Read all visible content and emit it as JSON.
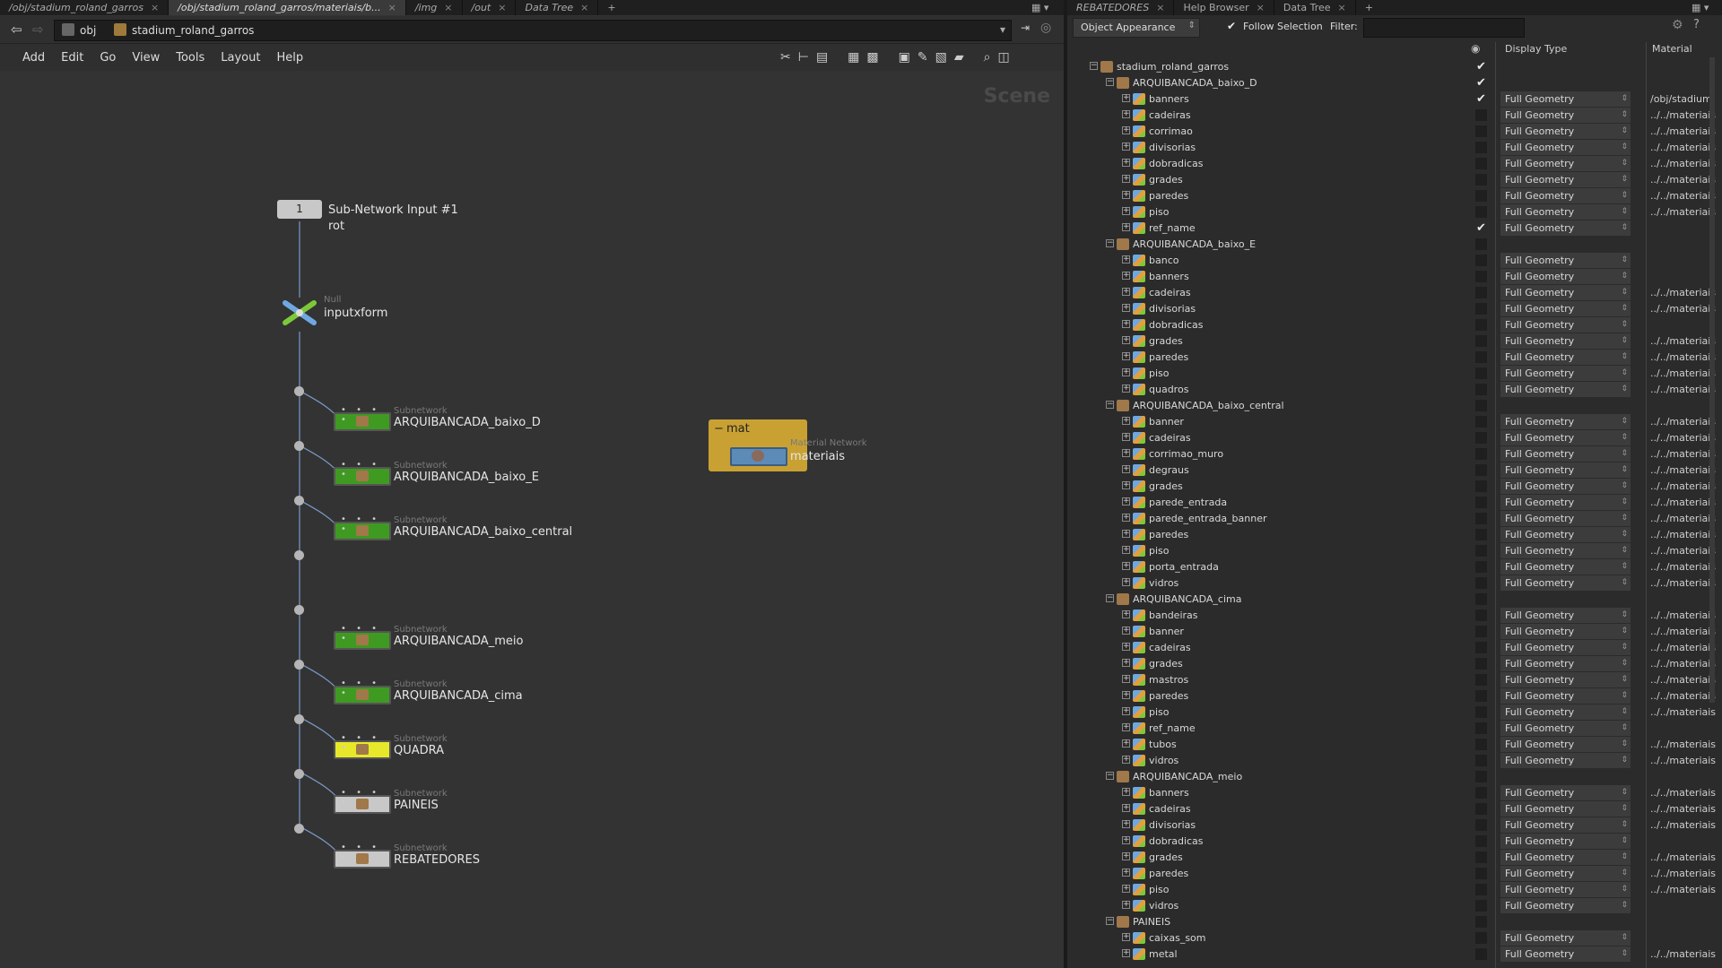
{
  "left_tabs": [
    {
      "label": "/obj/stadium_roland_garros"
    },
    {
      "label": "/obj/stadium_roland_garros/materiais/b..."
    },
    {
      "label": "/img"
    },
    {
      "label": "/out"
    },
    {
      "label": "Data Tree"
    }
  ],
  "path": {
    "root": "obj",
    "current": "stadium_roland_garros"
  },
  "menu": [
    "Add",
    "Edit",
    "Go",
    "View",
    "Tools",
    "Layout",
    "Help"
  ],
  "scene_label": "Scene",
  "nodes": {
    "input": {
      "num": "1",
      "label": "Sub-Network Input #1",
      "sub": "rot"
    },
    "null": {
      "type": "Null",
      "label": "inputxform"
    },
    "subnets": [
      {
        "type": "Subnetwork",
        "label": "ARQUIBANCADA_baixo_D",
        "color": "#3f9a22"
      },
      {
        "type": "Subnetwork",
        "label": "ARQUIBANCADA_baixo_E",
        "color": "#3f9a22"
      },
      {
        "type": "Subnetwork",
        "label": "ARQUIBANCADA_baixo_central",
        "color": "#3f9a22"
      },
      {
        "type": "Subnetwork",
        "label": "ARQUIBANCADA_meio",
        "color": "#3f9a22"
      },
      {
        "type": "Subnetwork",
        "label": "ARQUIBANCADA_cima",
        "color": "#3f9a22"
      },
      {
        "type": "Subnetwork",
        "label": "QUADRA",
        "color": "#e8e82a"
      },
      {
        "type": "Subnetwork",
        "label": "PAINEIS",
        "color": "#c8c8c8"
      },
      {
        "type": "Subnetwork",
        "label": "REBATEDORES",
        "color": "#c8c8c8"
      }
    ],
    "mat_box": {
      "title": "mat",
      "type": "Material Network",
      "label": "materiais"
    }
  },
  "right_tabs": [
    {
      "label": "REBATEDORES"
    },
    {
      "label": "Help Browser"
    },
    {
      "label": "Data Tree"
    }
  ],
  "toolbar": {
    "mode": "Object Appearance",
    "follow": "Follow Selection",
    "filter_label": "Filter:"
  },
  "headers": {
    "display": "Display Type",
    "material": "Material"
  },
  "tree": [
    {
      "name": "stadium_roland_garros",
      "level": 0,
      "kind": "root",
      "tick": true,
      "dt": "",
      "mat": ""
    },
    {
      "name": "ARQUIBANCADA_baixo_D",
      "level": 1,
      "kind": "group",
      "tick": true,
      "dt": "",
      "mat": ""
    },
    {
      "name": "banners",
      "level": 2,
      "kind": "geo",
      "tick": true,
      "dt": "Full Geometry",
      "mat": "/obj/stadium"
    },
    {
      "name": "cadeiras",
      "level": 2,
      "kind": "geo",
      "tick": false,
      "dt": "Full Geometry",
      "mat": "../../materiais"
    },
    {
      "name": "corrimao",
      "level": 2,
      "kind": "geo",
      "tick": false,
      "dt": "Full Geometry",
      "mat": "../../materiais"
    },
    {
      "name": "divisorias",
      "level": 2,
      "kind": "geo",
      "tick": false,
      "dt": "Full Geometry",
      "mat": "../../materiais"
    },
    {
      "name": "dobradicas",
      "level": 2,
      "kind": "geo",
      "tick": false,
      "dt": "Full Geometry",
      "mat": "../../materiais"
    },
    {
      "name": "grades",
      "level": 2,
      "kind": "geo",
      "tick": false,
      "dt": "Full Geometry",
      "mat": "../../materiais"
    },
    {
      "name": "paredes",
      "level": 2,
      "kind": "geo",
      "tick": false,
      "dt": "Full Geometry",
      "mat": "../../materiais"
    },
    {
      "name": "piso",
      "level": 2,
      "kind": "geo",
      "tick": false,
      "dt": "Full Geometry",
      "mat": "../../materiais"
    },
    {
      "name": "ref_name",
      "level": 2,
      "kind": "geo",
      "tick": true,
      "dt": "Full Geometry",
      "mat": ""
    },
    {
      "name": "ARQUIBANCADA_baixo_E",
      "level": 1,
      "kind": "group",
      "tick": false,
      "dt": "",
      "mat": ""
    },
    {
      "name": "banco",
      "level": 2,
      "kind": "geo",
      "tick": false,
      "dt": "Full Geometry",
      "mat": ""
    },
    {
      "name": "banners",
      "level": 2,
      "kind": "geo",
      "tick": false,
      "dt": "Full Geometry",
      "mat": ""
    },
    {
      "name": "cadeiras",
      "level": 2,
      "kind": "geo",
      "tick": false,
      "dt": "Full Geometry",
      "mat": "../../materiais"
    },
    {
      "name": "divisorias",
      "level": 2,
      "kind": "geo",
      "tick": false,
      "dt": "Full Geometry",
      "mat": "../../materiais"
    },
    {
      "name": "dobradicas",
      "level": 2,
      "kind": "geo",
      "tick": false,
      "dt": "Full Geometry",
      "mat": ""
    },
    {
      "name": "grades",
      "level": 2,
      "kind": "geo",
      "tick": false,
      "dt": "Full Geometry",
      "mat": "../../materiais"
    },
    {
      "name": "paredes",
      "level": 2,
      "kind": "geo",
      "tick": false,
      "dt": "Full Geometry",
      "mat": "../../materiais"
    },
    {
      "name": "piso",
      "level": 2,
      "kind": "geo",
      "tick": false,
      "dt": "Full Geometry",
      "mat": "../../materiais"
    },
    {
      "name": "quadros",
      "level": 2,
      "kind": "geo",
      "tick": false,
      "dt": "Full Geometry",
      "mat": "../../materiais"
    },
    {
      "name": "ARQUIBANCADA_baixo_central",
      "level": 1,
      "kind": "group",
      "tick": false,
      "dt": "",
      "mat": ""
    },
    {
      "name": "banner",
      "level": 2,
      "kind": "geo",
      "tick": false,
      "dt": "Full Geometry",
      "mat": "../../materiais"
    },
    {
      "name": "cadeiras",
      "level": 2,
      "kind": "geo",
      "tick": false,
      "dt": "Full Geometry",
      "mat": "../../materiais"
    },
    {
      "name": "corrimao_muro",
      "level": 2,
      "kind": "geo",
      "tick": false,
      "dt": "Full Geometry",
      "mat": "../../materiais"
    },
    {
      "name": "degraus",
      "level": 2,
      "kind": "geo",
      "tick": false,
      "dt": "Full Geometry",
      "mat": "../../materiais"
    },
    {
      "name": "grades",
      "level": 2,
      "kind": "geo",
      "tick": false,
      "dt": "Full Geometry",
      "mat": "../../materiais"
    },
    {
      "name": "parede_entrada",
      "level": 2,
      "kind": "geo",
      "tick": false,
      "dt": "Full Geometry",
      "mat": "../../materiais"
    },
    {
      "name": "parede_entrada_banner",
      "level": 2,
      "kind": "geo",
      "tick": false,
      "dt": "Full Geometry",
      "mat": "../../materiais"
    },
    {
      "name": "paredes",
      "level": 2,
      "kind": "geo",
      "tick": false,
      "dt": "Full Geometry",
      "mat": "../../materiais"
    },
    {
      "name": "piso",
      "level": 2,
      "kind": "geo",
      "tick": false,
      "dt": "Full Geometry",
      "mat": "../../materiais"
    },
    {
      "name": "porta_entrada",
      "level": 2,
      "kind": "geo",
      "tick": false,
      "dt": "Full Geometry",
      "mat": "../../materiais"
    },
    {
      "name": "vidros",
      "level": 2,
      "kind": "geo",
      "tick": false,
      "dt": "Full Geometry",
      "mat": "../../materiais"
    },
    {
      "name": "ARQUIBANCADA_cima",
      "level": 1,
      "kind": "group",
      "tick": false,
      "dt": "",
      "mat": ""
    },
    {
      "name": "bandeiras",
      "level": 2,
      "kind": "geo",
      "tick": false,
      "dt": "Full Geometry",
      "mat": "../../materiais"
    },
    {
      "name": "banner",
      "level": 2,
      "kind": "geo",
      "tick": false,
      "dt": "Full Geometry",
      "mat": "../../materiais"
    },
    {
      "name": "cadeiras",
      "level": 2,
      "kind": "geo",
      "tick": false,
      "dt": "Full Geometry",
      "mat": "../../materiais"
    },
    {
      "name": "grades",
      "level": 2,
      "kind": "geo",
      "tick": false,
      "dt": "Full Geometry",
      "mat": "../../materiais"
    },
    {
      "name": "mastros",
      "level": 2,
      "kind": "geo",
      "tick": false,
      "dt": "Full Geometry",
      "mat": "../../materiais"
    },
    {
      "name": "paredes",
      "level": 2,
      "kind": "geo",
      "tick": false,
      "dt": "Full Geometry",
      "mat": "../../materiais"
    },
    {
      "name": "piso",
      "level": 2,
      "kind": "geo",
      "tick": false,
      "dt": "Full Geometry",
      "mat": "../../materiais"
    },
    {
      "name": "ref_name",
      "level": 2,
      "kind": "geo",
      "tick": false,
      "dt": "Full Geometry",
      "mat": ""
    },
    {
      "name": "tubos",
      "level": 2,
      "kind": "geo",
      "tick": false,
      "dt": "Full Geometry",
      "mat": "../../materiais"
    },
    {
      "name": "vidros",
      "level": 2,
      "kind": "geo",
      "tick": false,
      "dt": "Full Geometry",
      "mat": "../../materiais"
    },
    {
      "name": "ARQUIBANCADA_meio",
      "level": 1,
      "kind": "group",
      "tick": false,
      "dt": "",
      "mat": ""
    },
    {
      "name": "banners",
      "level": 2,
      "kind": "geo",
      "tick": false,
      "dt": "Full Geometry",
      "mat": "../../materiais"
    },
    {
      "name": "cadeiras",
      "level": 2,
      "kind": "geo",
      "tick": false,
      "dt": "Full Geometry",
      "mat": "../../materiais"
    },
    {
      "name": "divisorias",
      "level": 2,
      "kind": "geo",
      "tick": false,
      "dt": "Full Geometry",
      "mat": "../../materiais"
    },
    {
      "name": "dobradicas",
      "level": 2,
      "kind": "geo",
      "tick": false,
      "dt": "Full Geometry",
      "mat": ""
    },
    {
      "name": "grades",
      "level": 2,
      "kind": "geo",
      "tick": false,
      "dt": "Full Geometry",
      "mat": "../../materiais"
    },
    {
      "name": "paredes",
      "level": 2,
      "kind": "geo",
      "tick": false,
      "dt": "Full Geometry",
      "mat": "../../materiais"
    },
    {
      "name": "piso",
      "level": 2,
      "kind": "geo",
      "tick": false,
      "dt": "Full Geometry",
      "mat": "../../materiais"
    },
    {
      "name": "vidros",
      "level": 2,
      "kind": "geo",
      "tick": false,
      "dt": "Full Geometry",
      "mat": ""
    },
    {
      "name": "PAINEIS",
      "level": 1,
      "kind": "group",
      "tick": false,
      "dt": "",
      "mat": ""
    },
    {
      "name": "caixas_som",
      "level": 2,
      "kind": "geo",
      "tick": false,
      "dt": "Full Geometry",
      "mat": ""
    },
    {
      "name": "metal",
      "level": 2,
      "kind": "geo",
      "tick": false,
      "dt": "Full Geometry",
      "mat": "../../materiais"
    }
  ]
}
